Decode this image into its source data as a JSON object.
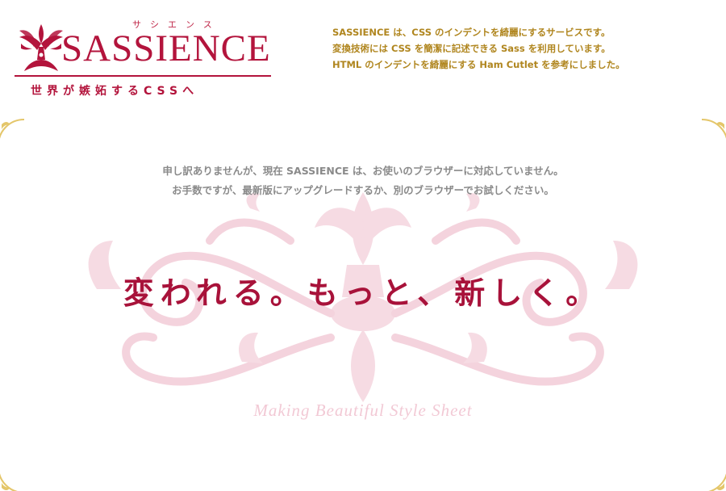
{
  "brand": {
    "kana": "サシエンス",
    "wordmark": "SASSIENCE",
    "tagline": "世界が嫉妬するCSSへ",
    "accent_color": "#b3143c"
  },
  "intro": {
    "lines": [
      "SASSIENCE は、CSS のインデントを綺麗にするサービスです。",
      "変換技術には CSS を簡潔に記述できる Sass を利用しています。",
      "HTML のインデントを綺麗にする Ham Cutlet を参考にしました。"
    ],
    "color": "#b0861f"
  },
  "notice": {
    "lines": [
      "申し訳ありませんが、現在 SASSIENCE は、お使いのブラウザーに対応していません。",
      "お手数ですが、最新版にアップグレードするか、別のブラウザーでお試しください。"
    ]
  },
  "slogan": "変われる。もっと、新しく。",
  "script_tagline": "Making Beautiful Style Sheet",
  "icons": {
    "crest": "fleur-crest-icon",
    "corner": "gold-corner-flourish-icon",
    "ornament": "damask-ornament"
  }
}
